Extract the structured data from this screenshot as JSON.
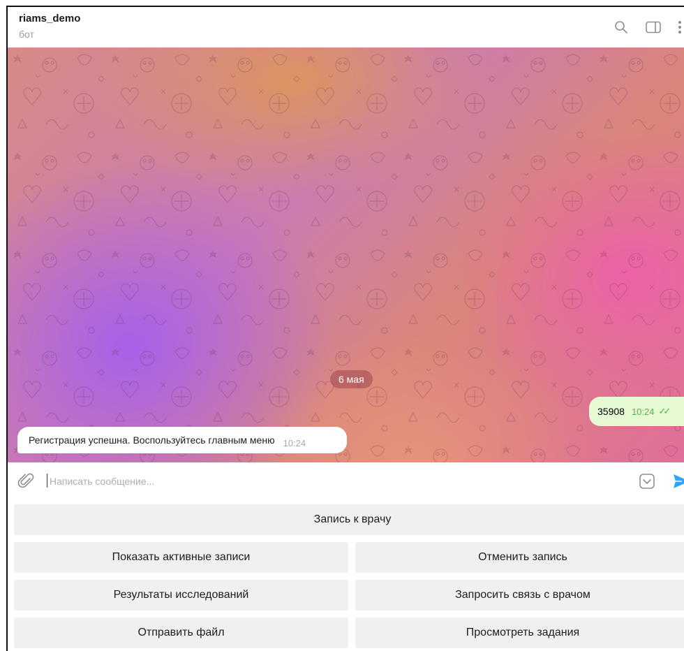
{
  "header": {
    "title": "riams_demo",
    "subtitle": "бот",
    "icons": [
      "search-icon",
      "side-panel-icon",
      "more-vertical-icon"
    ]
  },
  "chat": {
    "date_label": "6 мая",
    "messages": [
      {
        "direction": "out",
        "text": "35908",
        "time": "10:24",
        "status": "read"
      },
      {
        "direction": "in",
        "text": "Регистрация успешна. Воспользуйтесь главным меню",
        "time": "10:24"
      }
    ]
  },
  "composer": {
    "placeholder": "Написать сообщение...",
    "value": "",
    "icons": [
      "paperclip-icon",
      "keyboard-toggle-icon",
      "send-icon"
    ]
  },
  "keyboard": {
    "buttons": [
      "Запись к врачу",
      "Показать активные записи",
      "Отменить запись",
      "Результаты исследований",
      "Запросить связь с врачом",
      "Отправить файл",
      "Просмотреть задания"
    ]
  },
  "colors": {
    "outgoing_bubble": "#e6fbd3",
    "outgoing_time": "#55b14a",
    "send_icon": "#2ea6ff",
    "keyboard_button": "#f0f0f0"
  }
}
